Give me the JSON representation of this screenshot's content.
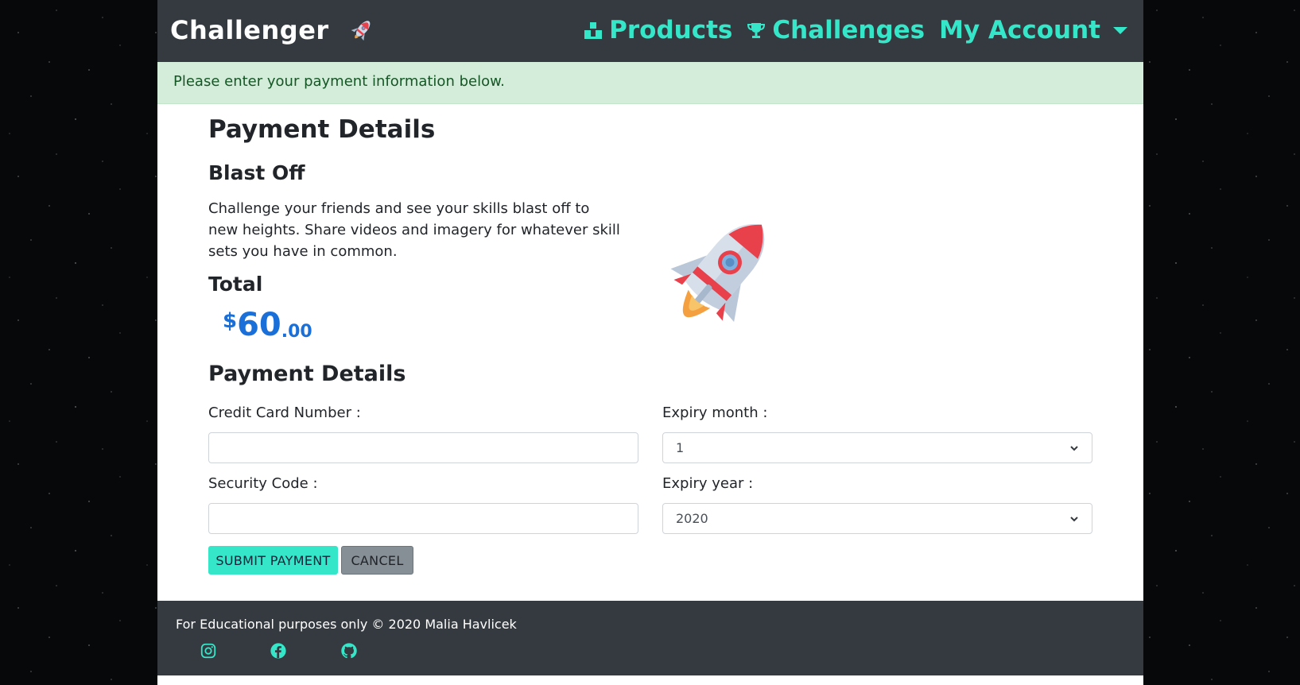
{
  "navbar": {
    "brand": "Challenger",
    "brand_icon": "rocket-icon",
    "links": [
      {
        "label": "Products",
        "icon": "cubes-icon"
      },
      {
        "label": "Challenges",
        "icon": "trophy-icon"
      },
      {
        "label": "My Account",
        "icon": "chevron-down-icon"
      }
    ]
  },
  "alert": {
    "text": "Please enter your payment information below."
  },
  "main": {
    "title": "Payment Details",
    "product_name": "Blast Off",
    "product_description": "Challenge your friends and see your skills blast off to new heights. Share videos and imagery for whatever skill sets you have in common.",
    "total_heading": "Total",
    "price": {
      "currency": "$",
      "integer": "60",
      "decimal": ".00"
    },
    "product_image": "rocket-illustration",
    "form_title": "Payment Details",
    "card_label": "Credit Card Number :",
    "card_value": "",
    "security_label": "Security Code :",
    "security_value": "",
    "expiry_month_label": "Expiry month :",
    "expiry_month_value": "1",
    "expiry_year_label": "Expiry year :",
    "expiry_year_value": "2020",
    "submit_label": "SUBMIT PAYMENT",
    "cancel_label": "CANCEL"
  },
  "footer": {
    "text": "For Educational purposes only © 2020 Malia Havlicek",
    "icons": [
      "instagram-icon",
      "facebook-icon",
      "github-icon"
    ]
  },
  "colors": {
    "accent": "#36e6c8",
    "navbar": "#343a40",
    "alert_bg": "#d4edda",
    "alert_text": "#155724",
    "price": "#1a6fd8"
  }
}
